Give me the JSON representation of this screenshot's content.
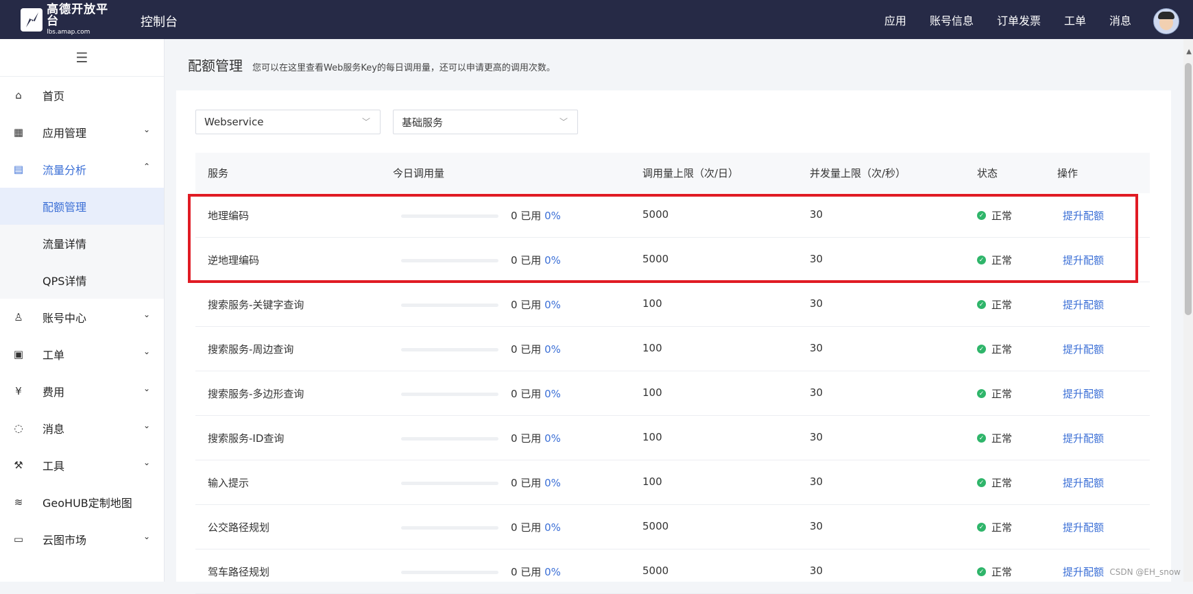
{
  "topbar": {
    "logo_cn": "高德开放平台",
    "logo_en": "lbs.amap.com",
    "console_title": "控制台",
    "nav": [
      "应用",
      "账号信息",
      "订单发票",
      "工单",
      "消息"
    ]
  },
  "sidebar": {
    "collapse_icon": "menu-icon",
    "items": [
      {
        "label": "首页",
        "icon": "home-icon"
      },
      {
        "label": "应用管理",
        "icon": "grid-icon"
      },
      {
        "label": "流量分析",
        "icon": "chart-icon"
      },
      {
        "label": "账号中心",
        "icon": "user-icon"
      },
      {
        "label": "工单",
        "icon": "ticket-icon"
      },
      {
        "label": "费用",
        "icon": "money-icon"
      },
      {
        "label": "消息",
        "icon": "message-icon"
      },
      {
        "label": "工具",
        "icon": "wrench-icon"
      },
      {
        "label": "GeoHUB定制地图",
        "icon": "layers-icon"
      },
      {
        "label": "云图市场",
        "icon": "store-icon"
      }
    ],
    "sub_items": [
      "配额管理",
      "流量详情",
      "QPS详情"
    ]
  },
  "page": {
    "title": "配额管理",
    "description": "您可以在这里查看Web服务Key的每日调用量，还可以申请更高的调用次数。"
  },
  "filters": {
    "type": "Webservice",
    "category": "基础服务"
  },
  "table": {
    "headers": [
      "服务",
      "今日调用量",
      "调用量上限（次/日）",
      "并发量上限（次/秒）",
      "状态",
      "操作"
    ],
    "rows": [
      {
        "service": "地理编码",
        "used": "0 已用",
        "pct": "0%",
        "progress": 0,
        "limit": "5000",
        "concurrency": "30",
        "status": "正常",
        "action": "提升配额"
      },
      {
        "service": "逆地理编码",
        "used": "0 已用",
        "pct": "0%",
        "progress": 0,
        "limit": "5000",
        "concurrency": "30",
        "status": "正常",
        "action": "提升配额"
      },
      {
        "service": "搜索服务-关键字查询",
        "used": "0 已用",
        "pct": "0%",
        "progress": 0,
        "limit": "100",
        "concurrency": "30",
        "status": "正常",
        "action": "提升配额"
      },
      {
        "service": "搜索服务-周边查询",
        "used": "0 已用",
        "pct": "0%",
        "progress": 0,
        "limit": "100",
        "concurrency": "30",
        "status": "正常",
        "action": "提升配额"
      },
      {
        "service": "搜索服务-多边形查询",
        "used": "0 已用",
        "pct": "0%",
        "progress": 0,
        "limit": "100",
        "concurrency": "30",
        "status": "正常",
        "action": "提升配额"
      },
      {
        "service": "搜索服务-ID查询",
        "used": "0 已用",
        "pct": "0%",
        "progress": 0,
        "limit": "100",
        "concurrency": "30",
        "status": "正常",
        "action": "提升配额"
      },
      {
        "service": "输入提示",
        "used": "0 已用",
        "pct": "0%",
        "progress": 0,
        "limit": "100",
        "concurrency": "30",
        "status": "正常",
        "action": "提升配额"
      },
      {
        "service": "公交路径规划",
        "used": "0 已用",
        "pct": "0%",
        "progress": 0,
        "limit": "5000",
        "concurrency": "30",
        "status": "正常",
        "action": "提升配额"
      },
      {
        "service": "驾车路径规划",
        "used": "0 已用",
        "pct": "0%",
        "progress": 0,
        "limit": "5000",
        "concurrency": "30",
        "status": "正常",
        "action": "提升配额"
      }
    ]
  },
  "colors": {
    "topbar_bg": "#262a46",
    "accent": "#3b6fd6",
    "status_ok": "#2fb56a",
    "highlight": "#e01b24"
  },
  "watermark": "CSDN @EH_snow"
}
